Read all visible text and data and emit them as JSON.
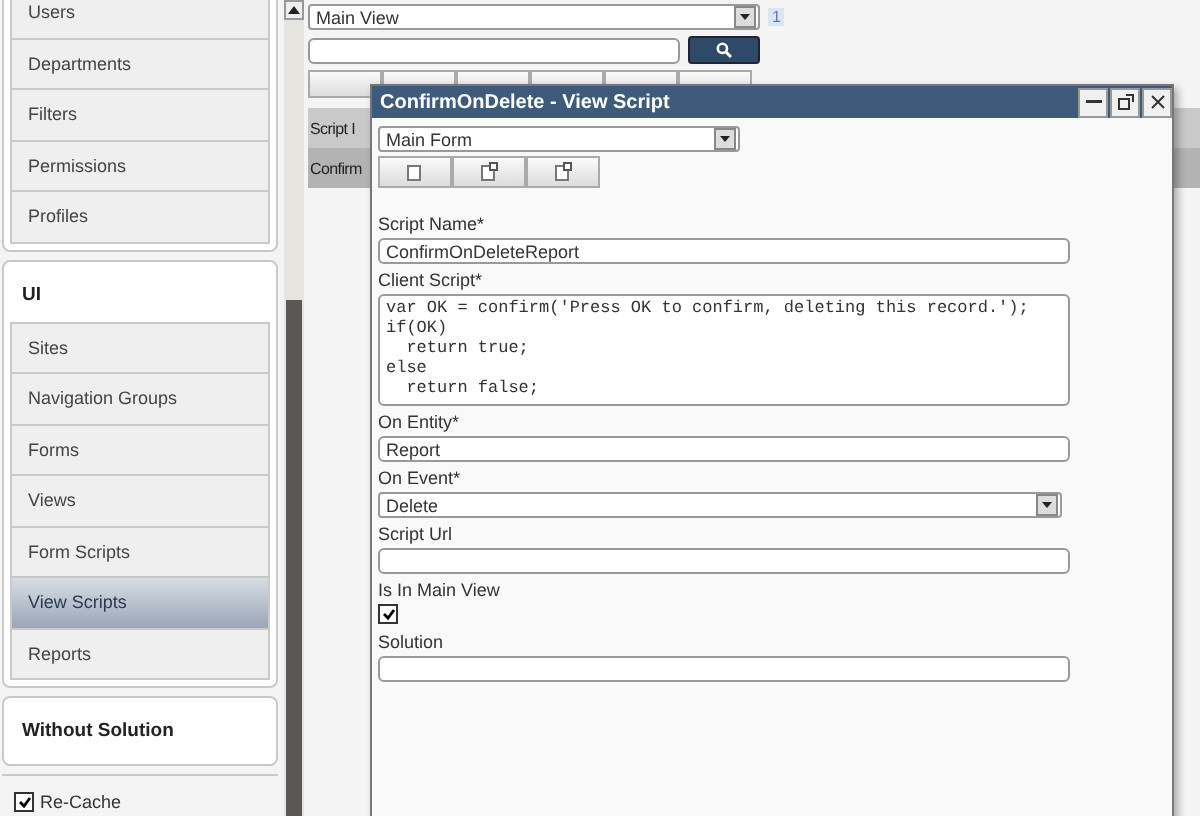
{
  "sidebar": {
    "groups": [
      {
        "items": [
          {
            "label": "Users",
            "selected": false
          },
          {
            "label": "Departments",
            "selected": false
          },
          {
            "label": "Filters",
            "selected": false
          },
          {
            "label": "Permissions",
            "selected": false
          },
          {
            "label": "Profiles",
            "selected": false
          }
        ]
      },
      {
        "label": "UI",
        "items": [
          {
            "label": "Sites",
            "selected": false
          },
          {
            "label": "Navigation Groups",
            "selected": false
          },
          {
            "label": "Forms",
            "selected": false
          },
          {
            "label": "Views",
            "selected": false
          },
          {
            "label": "Form Scripts",
            "selected": false
          },
          {
            "label": "View Scripts",
            "selected": true
          },
          {
            "label": "Reports",
            "selected": false
          }
        ]
      },
      {
        "label": "Without Solution"
      }
    ],
    "recache": {
      "label": "Re-Cache",
      "checked": true
    }
  },
  "main": {
    "view_select": "Main View",
    "page_badge": "1",
    "grid": {
      "column_1": "Script I",
      "row_1": "Confirm"
    }
  },
  "dialog": {
    "title": "ConfirmOnDelete - View Script",
    "form_select": "Main Form",
    "fields": [
      {
        "kind": "text",
        "label": "Script Name*",
        "value": "ConfirmOnDeleteReport"
      },
      {
        "kind": "code",
        "label": "Client Script*",
        "value": "var OK = confirm('Press OK to confirm, deleting this record.');\nif(OK)\n  return true;\nelse\n  return false;"
      },
      {
        "kind": "text",
        "label": "On Entity*",
        "value": "Report"
      },
      {
        "kind": "select",
        "label": "On Event*",
        "value": "Delete"
      },
      {
        "kind": "text",
        "label": "Script Url"
      },
      {
        "kind": "checkbox",
        "label": "Is In Main View",
        "checked": true
      },
      {
        "kind": "text",
        "label": "Solution"
      }
    ]
  }
}
